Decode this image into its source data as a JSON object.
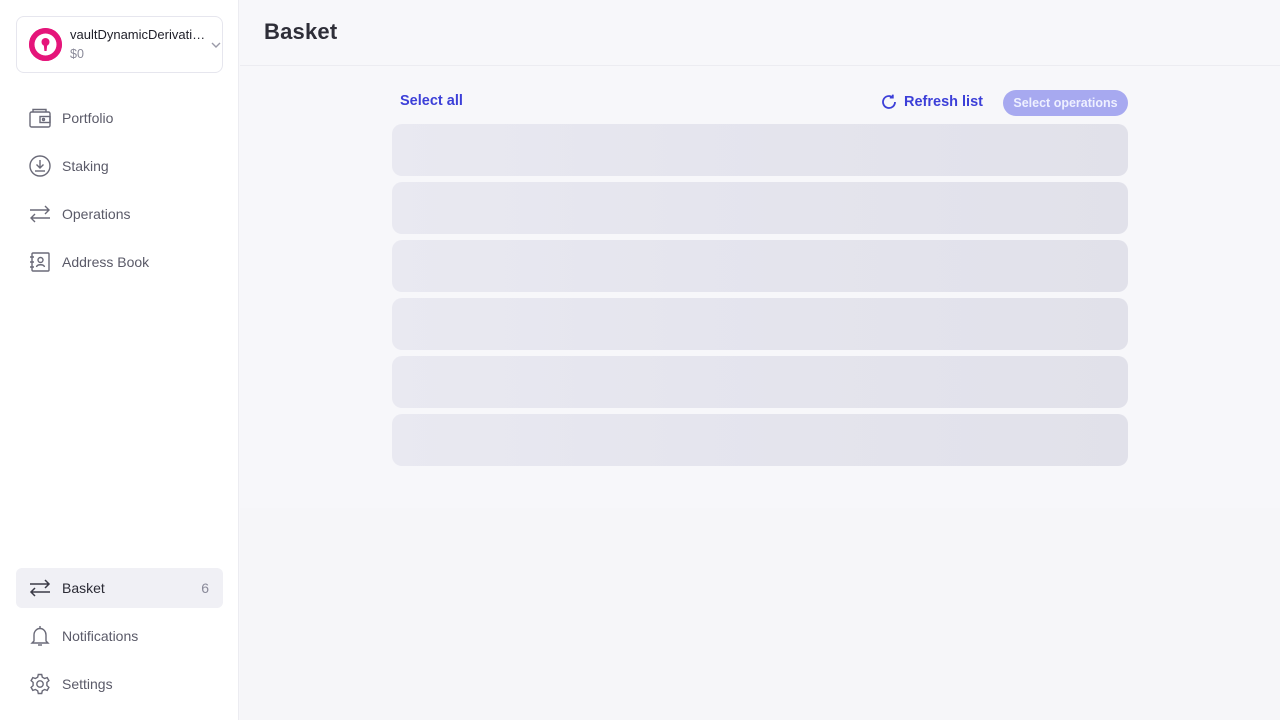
{
  "vault": {
    "name": "vaultDynamicDerivatio...",
    "balance": "$0",
    "logo_color": "#e5157a"
  },
  "nav": {
    "top": [
      {
        "label": "Portfolio",
        "icon": "wallet-icon"
      },
      {
        "label": "Staking",
        "icon": "staking-icon"
      },
      {
        "label": "Operations",
        "icon": "arrows-swap-icon"
      },
      {
        "label": "Address Book",
        "icon": "address-book-icon"
      }
    ],
    "bottom": [
      {
        "label": "Basket",
        "icon": "arrows-swap-icon",
        "count": "6",
        "active": true
      },
      {
        "label": "Notifications",
        "icon": "bell-icon"
      },
      {
        "label": "Settings",
        "icon": "gear-icon"
      }
    ]
  },
  "page": {
    "title": "Basket"
  },
  "toolbar": {
    "select_all": "Select all",
    "refresh": "Refresh list",
    "select_operations": "Select operations"
  },
  "list": {
    "loading_rows": 6
  },
  "colors": {
    "accent": "#3c3fd8",
    "accent_disabled": "#a7a9f0"
  }
}
